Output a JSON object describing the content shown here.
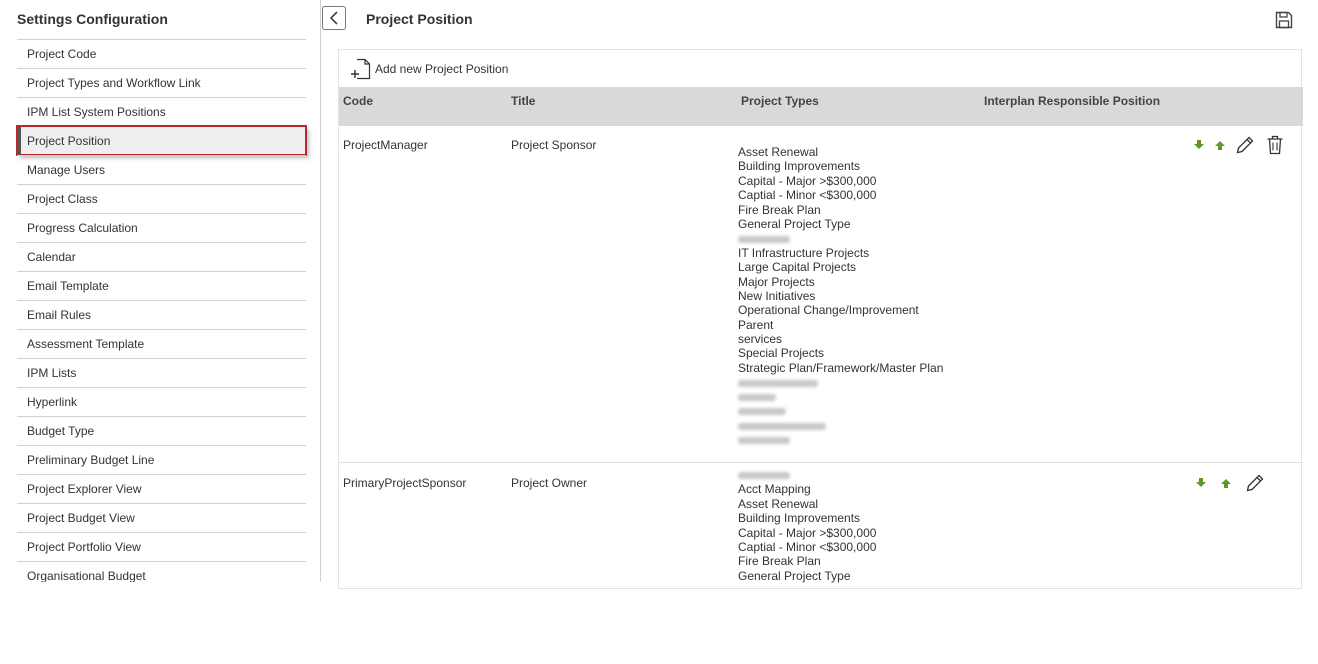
{
  "sidebar": {
    "title": "Settings Configuration",
    "items": [
      {
        "label": "Project Code"
      },
      {
        "label": "Project Types and Workflow Link"
      },
      {
        "label": "IPM List System Positions"
      },
      {
        "label": "Project Position",
        "active": true
      },
      {
        "label": "Manage Users"
      },
      {
        "label": "Project Class"
      },
      {
        "label": "Progress Calculation"
      },
      {
        "label": "Calendar"
      },
      {
        "label": "Email Template"
      },
      {
        "label": "Email Rules"
      },
      {
        "label": "Assessment Template"
      },
      {
        "label": "IPM Lists"
      },
      {
        "label": "Hyperlink"
      },
      {
        "label": "Budget Type"
      },
      {
        "label": "Preliminary Budget Line"
      },
      {
        "label": "Project Explorer View"
      },
      {
        "label": "Project Budget View"
      },
      {
        "label": "Project Portfolio View"
      },
      {
        "label": "Organisational Budget"
      }
    ]
  },
  "header": {
    "title": "Project Position"
  },
  "toolbar": {
    "add_label": "Add new Project Position"
  },
  "table": {
    "columns": [
      "Code",
      "Title",
      "Project Types",
      "Interplan Responsible Position"
    ],
    "rows": [
      {
        "code": "ProjectManager",
        "title": "Project Sponsor",
        "responsible": "",
        "project_types": [
          "Asset Renewal",
          "Building Improvements",
          "Capital - Major >$300,000",
          "Captial - Minor <$300,000",
          "Fire Break Plan",
          "General Project Type",
          "",
          "IT Infrastructure Projects",
          "Large Capital Projects",
          "Major Projects",
          "New Initiatives",
          "Operational Change/Improvement",
          "Parent",
          "services",
          "Special Projects",
          "Strategic Plan/Framework/Master Plan",
          "",
          "",
          "",
          "",
          ""
        ],
        "has_delete": true
      },
      {
        "code": "PrimaryProjectSponsor",
        "title": "Project Owner",
        "responsible": "",
        "project_types": [
          "",
          "Acct Mapping",
          "Asset Renewal",
          "Building Improvements",
          "Capital - Major >$300,000",
          "Captial - Minor <$300,000",
          "Fire Break Plan",
          "General Project Type"
        ],
        "has_delete": false
      }
    ]
  },
  "colors": {
    "active_outline": "#b7262a",
    "header_bg": "#d9d9d9",
    "arrow_green": "#5a9a2a"
  }
}
